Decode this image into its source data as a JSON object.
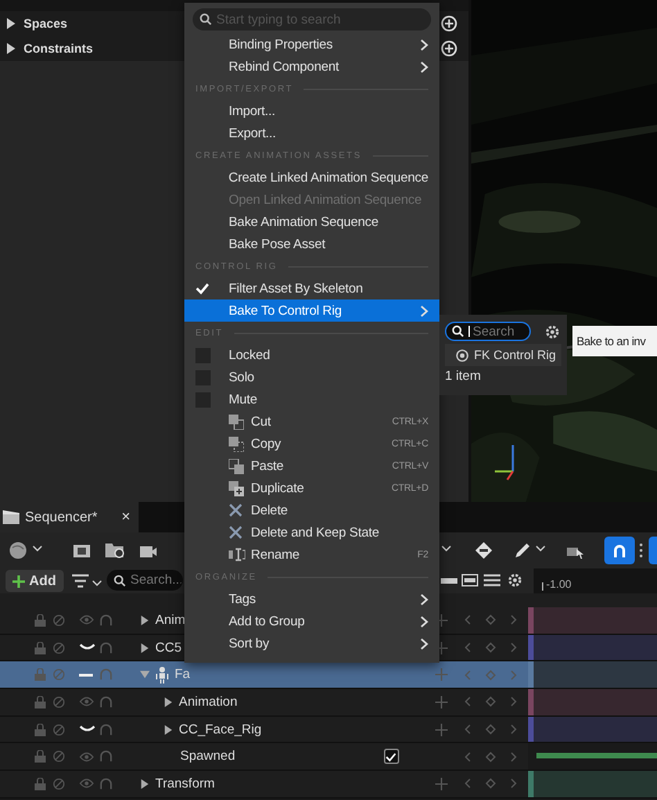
{
  "details_panel": {
    "items": [
      {
        "label": "Spaces",
        "expanded": false
      },
      {
        "label": "Constraints",
        "expanded": false
      }
    ]
  },
  "sequencer": {
    "tab": {
      "title": "Sequencer*",
      "close": "×"
    },
    "toolbar": {
      "snap_on": true
    },
    "add_button": "Add",
    "search": {
      "placeholder": "Search..."
    },
    "ruler_label": "-1.00",
    "tracks": [
      {
        "name": "Anim",
        "expanded": false,
        "selected": false,
        "hidden": false,
        "mixed": false,
        "color": "#7a4560"
      },
      {
        "name": "CC5",
        "expanded": false,
        "selected": false,
        "hidden": true,
        "mixed": false,
        "color": "#4c4c9a"
      },
      {
        "name": "Fa",
        "expanded": true,
        "selected": true,
        "hidden": false,
        "mixed": true,
        "color": "#5a7aa0",
        "children": [
          {
            "name": "Animation",
            "expanded": false,
            "selected": false,
            "hidden": false,
            "mixed": false,
            "color": "#7a4560"
          },
          {
            "name": "CC_Face_Rig",
            "expanded": false,
            "selected": false,
            "hidden": true,
            "mixed": false,
            "color": "#4c4c9a"
          },
          {
            "name": "Spawned",
            "kind": "property",
            "checked": true,
            "selected": false,
            "hidden": false,
            "mixed": false
          }
        ]
      },
      {
        "name": "Transform",
        "expanded": false,
        "selected": false,
        "hidden": false,
        "mixed": false,
        "color": "#3e7a68"
      }
    ]
  },
  "context_menu": {
    "search": {
      "placeholder": "Start typing to search"
    },
    "items": [
      {
        "kind": "item",
        "label": "Binding Properties",
        "submenu": true,
        "selected": false,
        "disabled": false
      },
      {
        "kind": "item",
        "label": "Rebind Component",
        "submenu": true,
        "selected": false,
        "disabled": false
      },
      {
        "kind": "header",
        "label": "IMPORT/EXPORT"
      },
      {
        "kind": "item",
        "label": "Import...",
        "submenu": false,
        "selected": false,
        "disabled": false
      },
      {
        "kind": "item",
        "label": "Export...",
        "submenu": false,
        "selected": false,
        "disabled": false
      },
      {
        "kind": "header",
        "label": "CREATE ANIMATION ASSETS"
      },
      {
        "kind": "item",
        "label": "Create Linked Animation Sequence",
        "submenu": false,
        "selected": false,
        "disabled": false
      },
      {
        "kind": "item",
        "label": "Open Linked Animation Sequence",
        "submenu": false,
        "selected": false,
        "disabled": true
      },
      {
        "kind": "item",
        "label": "Bake Animation Sequence",
        "submenu": false,
        "selected": false,
        "disabled": false
      },
      {
        "kind": "item",
        "label": "Bake Pose Asset",
        "submenu": false,
        "selected": false,
        "disabled": false
      },
      {
        "kind": "header",
        "label": "CONTROL RIG"
      },
      {
        "kind": "check",
        "label": "Filter Asset By Skeleton",
        "checked": true,
        "submenu": false,
        "selected": false,
        "disabled": false
      },
      {
        "kind": "item",
        "label": "Bake To Control Rig",
        "submenu": true,
        "selected": true,
        "disabled": false
      },
      {
        "kind": "header",
        "label": "EDIT"
      },
      {
        "kind": "check",
        "label": "Locked",
        "checked": false,
        "submenu": false,
        "selected": false,
        "disabled": false
      },
      {
        "kind": "check",
        "label": "Solo",
        "checked": false,
        "submenu": false,
        "selected": false,
        "disabled": false
      },
      {
        "kind": "check",
        "label": "Mute",
        "checked": false,
        "submenu": false,
        "selected": false,
        "disabled": false
      },
      {
        "kind": "cut",
        "label": "Cut",
        "shortcut": "CTRL+X",
        "submenu": false,
        "selected": false,
        "disabled": false
      },
      {
        "kind": "copy",
        "label": "Copy",
        "shortcut": "CTRL+C",
        "submenu": false,
        "selected": false,
        "disabled": false
      },
      {
        "kind": "paste",
        "label": "Paste",
        "shortcut": "CTRL+V",
        "submenu": false,
        "selected": false,
        "disabled": false
      },
      {
        "kind": "duplicate",
        "label": "Duplicate",
        "shortcut": "CTRL+D",
        "submenu": false,
        "selected": false,
        "disabled": false
      },
      {
        "kind": "delete",
        "label": "Delete",
        "submenu": false,
        "selected": false,
        "disabled": false
      },
      {
        "kind": "delete",
        "label": "Delete and Keep State",
        "submenu": false,
        "selected": false,
        "disabled": false
      },
      {
        "kind": "rename",
        "label": "Rename",
        "shortcut": "F2",
        "submenu": false,
        "selected": false,
        "disabled": false
      },
      {
        "kind": "header",
        "label": "ORGANIZE"
      },
      {
        "kind": "item",
        "label": "Tags",
        "submenu": true,
        "selected": false,
        "disabled": false
      },
      {
        "kind": "item",
        "label": "Add to Group",
        "submenu": true,
        "selected": false,
        "disabled": false
      },
      {
        "kind": "item",
        "label": "Sort by",
        "submenu": true,
        "selected": false,
        "disabled": false
      }
    ]
  },
  "submenu": {
    "search": {
      "placeholder": "Search",
      "focused": true
    },
    "items": [
      {
        "label": "FK Control Rig",
        "selected": false
      }
    ],
    "count": "1 item"
  },
  "tooltip": {
    "text": "Bake to an inv"
  }
}
